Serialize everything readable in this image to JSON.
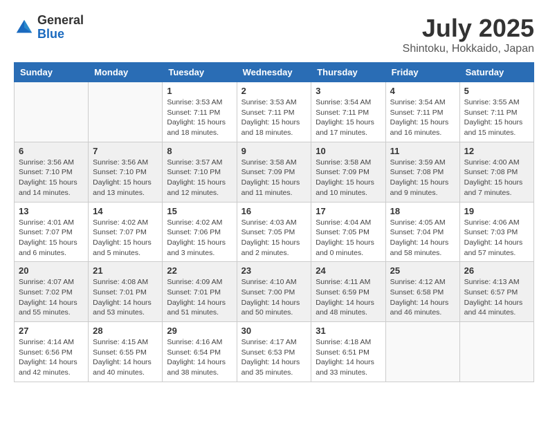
{
  "header": {
    "logo_general": "General",
    "logo_blue": "Blue",
    "title": "July 2025",
    "location": "Shintoku, Hokkaido, Japan"
  },
  "days_of_week": [
    "Sunday",
    "Monday",
    "Tuesday",
    "Wednesday",
    "Thursday",
    "Friday",
    "Saturday"
  ],
  "weeks": [
    [
      {
        "day": "",
        "info": ""
      },
      {
        "day": "",
        "info": ""
      },
      {
        "day": "1",
        "info": "Sunrise: 3:53 AM\nSunset: 7:11 PM\nDaylight: 15 hours\nand 18 minutes."
      },
      {
        "day": "2",
        "info": "Sunrise: 3:53 AM\nSunset: 7:11 PM\nDaylight: 15 hours\nand 18 minutes."
      },
      {
        "day": "3",
        "info": "Sunrise: 3:54 AM\nSunset: 7:11 PM\nDaylight: 15 hours\nand 17 minutes."
      },
      {
        "day": "4",
        "info": "Sunrise: 3:54 AM\nSunset: 7:11 PM\nDaylight: 15 hours\nand 16 minutes."
      },
      {
        "day": "5",
        "info": "Sunrise: 3:55 AM\nSunset: 7:11 PM\nDaylight: 15 hours\nand 15 minutes."
      }
    ],
    [
      {
        "day": "6",
        "info": "Sunrise: 3:56 AM\nSunset: 7:10 PM\nDaylight: 15 hours\nand 14 minutes."
      },
      {
        "day": "7",
        "info": "Sunrise: 3:56 AM\nSunset: 7:10 PM\nDaylight: 15 hours\nand 13 minutes."
      },
      {
        "day": "8",
        "info": "Sunrise: 3:57 AM\nSunset: 7:10 PM\nDaylight: 15 hours\nand 12 minutes."
      },
      {
        "day": "9",
        "info": "Sunrise: 3:58 AM\nSunset: 7:09 PM\nDaylight: 15 hours\nand 11 minutes."
      },
      {
        "day": "10",
        "info": "Sunrise: 3:58 AM\nSunset: 7:09 PM\nDaylight: 15 hours\nand 10 minutes."
      },
      {
        "day": "11",
        "info": "Sunrise: 3:59 AM\nSunset: 7:08 PM\nDaylight: 15 hours\nand 9 minutes."
      },
      {
        "day": "12",
        "info": "Sunrise: 4:00 AM\nSunset: 7:08 PM\nDaylight: 15 hours\nand 7 minutes."
      }
    ],
    [
      {
        "day": "13",
        "info": "Sunrise: 4:01 AM\nSunset: 7:07 PM\nDaylight: 15 hours\nand 6 minutes."
      },
      {
        "day": "14",
        "info": "Sunrise: 4:02 AM\nSunset: 7:07 PM\nDaylight: 15 hours\nand 5 minutes."
      },
      {
        "day": "15",
        "info": "Sunrise: 4:02 AM\nSunset: 7:06 PM\nDaylight: 15 hours\nand 3 minutes."
      },
      {
        "day": "16",
        "info": "Sunrise: 4:03 AM\nSunset: 7:05 PM\nDaylight: 15 hours\nand 2 minutes."
      },
      {
        "day": "17",
        "info": "Sunrise: 4:04 AM\nSunset: 7:05 PM\nDaylight: 15 hours\nand 0 minutes."
      },
      {
        "day": "18",
        "info": "Sunrise: 4:05 AM\nSunset: 7:04 PM\nDaylight: 14 hours\nand 58 minutes."
      },
      {
        "day": "19",
        "info": "Sunrise: 4:06 AM\nSunset: 7:03 PM\nDaylight: 14 hours\nand 57 minutes."
      }
    ],
    [
      {
        "day": "20",
        "info": "Sunrise: 4:07 AM\nSunset: 7:02 PM\nDaylight: 14 hours\nand 55 minutes."
      },
      {
        "day": "21",
        "info": "Sunrise: 4:08 AM\nSunset: 7:01 PM\nDaylight: 14 hours\nand 53 minutes."
      },
      {
        "day": "22",
        "info": "Sunrise: 4:09 AM\nSunset: 7:01 PM\nDaylight: 14 hours\nand 51 minutes."
      },
      {
        "day": "23",
        "info": "Sunrise: 4:10 AM\nSunset: 7:00 PM\nDaylight: 14 hours\nand 50 minutes."
      },
      {
        "day": "24",
        "info": "Sunrise: 4:11 AM\nSunset: 6:59 PM\nDaylight: 14 hours\nand 48 minutes."
      },
      {
        "day": "25",
        "info": "Sunrise: 4:12 AM\nSunset: 6:58 PM\nDaylight: 14 hours\nand 46 minutes."
      },
      {
        "day": "26",
        "info": "Sunrise: 4:13 AM\nSunset: 6:57 PM\nDaylight: 14 hours\nand 44 minutes."
      }
    ],
    [
      {
        "day": "27",
        "info": "Sunrise: 4:14 AM\nSunset: 6:56 PM\nDaylight: 14 hours\nand 42 minutes."
      },
      {
        "day": "28",
        "info": "Sunrise: 4:15 AM\nSunset: 6:55 PM\nDaylight: 14 hours\nand 40 minutes."
      },
      {
        "day": "29",
        "info": "Sunrise: 4:16 AM\nSunset: 6:54 PM\nDaylight: 14 hours\nand 38 minutes."
      },
      {
        "day": "30",
        "info": "Sunrise: 4:17 AM\nSunset: 6:53 PM\nDaylight: 14 hours\nand 35 minutes."
      },
      {
        "day": "31",
        "info": "Sunrise: 4:18 AM\nSunset: 6:51 PM\nDaylight: 14 hours\nand 33 minutes."
      },
      {
        "day": "",
        "info": ""
      },
      {
        "day": "",
        "info": ""
      }
    ]
  ]
}
